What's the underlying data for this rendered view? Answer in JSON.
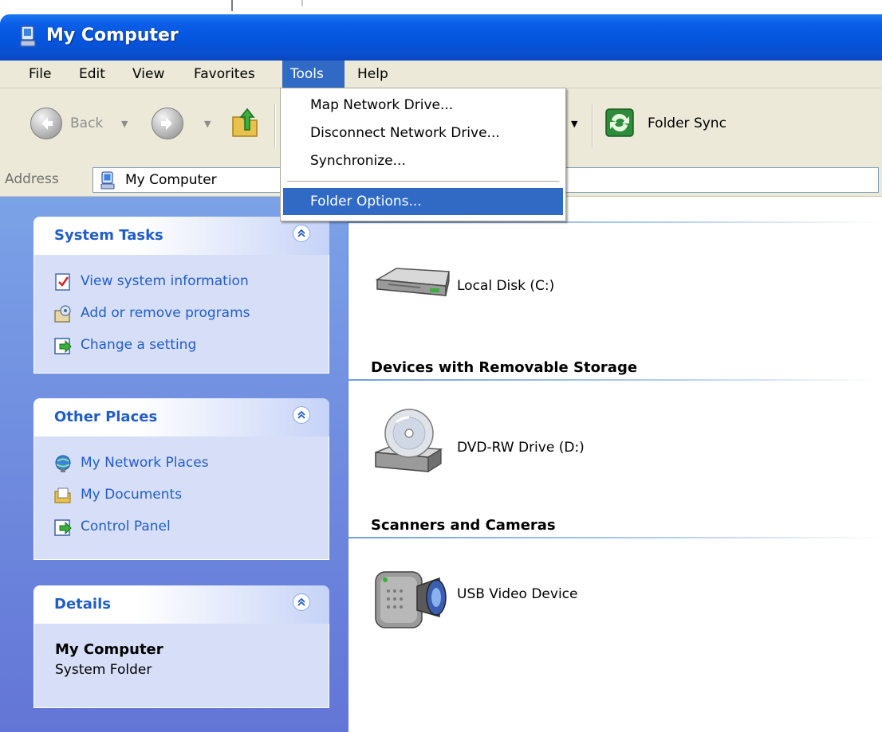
{
  "window": {
    "title": "My Computer"
  },
  "menubar": {
    "items": [
      {
        "label": "File"
      },
      {
        "label": "Edit"
      },
      {
        "label": "View"
      },
      {
        "label": "Favorites"
      },
      {
        "label": "Tools"
      },
      {
        "label": "Help"
      }
    ],
    "active": "Tools"
  },
  "toolbar": {
    "back_label": "Back",
    "folder_sync_label": "Folder Sync"
  },
  "tools_menu": {
    "items": [
      {
        "label": "Map Network Drive..."
      },
      {
        "label": "Disconnect Network Drive..."
      },
      {
        "label": "Synchronize..."
      },
      {
        "label": "Folder Options..."
      }
    ],
    "highlighted": "Folder Options..."
  },
  "address": {
    "label": "Address",
    "value": "My Computer"
  },
  "task_pane": {
    "system_tasks": {
      "title": "System Tasks",
      "links": [
        {
          "label": "View system information",
          "icon": "system-info-icon"
        },
        {
          "label": "Add or remove programs",
          "icon": "add-remove-programs-icon"
        },
        {
          "label": "Change a setting",
          "icon": "control-panel-icon"
        }
      ]
    },
    "other_places": {
      "title": "Other Places",
      "links": [
        {
          "label": "My Network Places",
          "icon": "network-places-icon"
        },
        {
          "label": "My Documents",
          "icon": "my-documents-icon"
        },
        {
          "label": "Control Panel",
          "icon": "control-panel-icon"
        }
      ]
    },
    "details": {
      "title": "Details",
      "name": "My Computer",
      "type": "System Folder"
    }
  },
  "content": {
    "groups": [
      {
        "title": "",
        "items": [
          {
            "label": "Local Disk (C:)",
            "icon": "hard-disk-icon"
          }
        ]
      },
      {
        "title": "Devices with Removable Storage",
        "items": [
          {
            "label": "DVD-RW Drive (D:)",
            "icon": "dvd-drive-icon"
          }
        ]
      },
      {
        "title": "Scanners and Cameras",
        "items": [
          {
            "label": "USB Video Device",
            "icon": "video-camera-icon"
          }
        ]
      }
    ]
  },
  "colors": {
    "titlebar": "#0555dd",
    "menu_highlight": "#316ac5",
    "link": "#215dc6",
    "task_pane": "#6f8ede"
  }
}
